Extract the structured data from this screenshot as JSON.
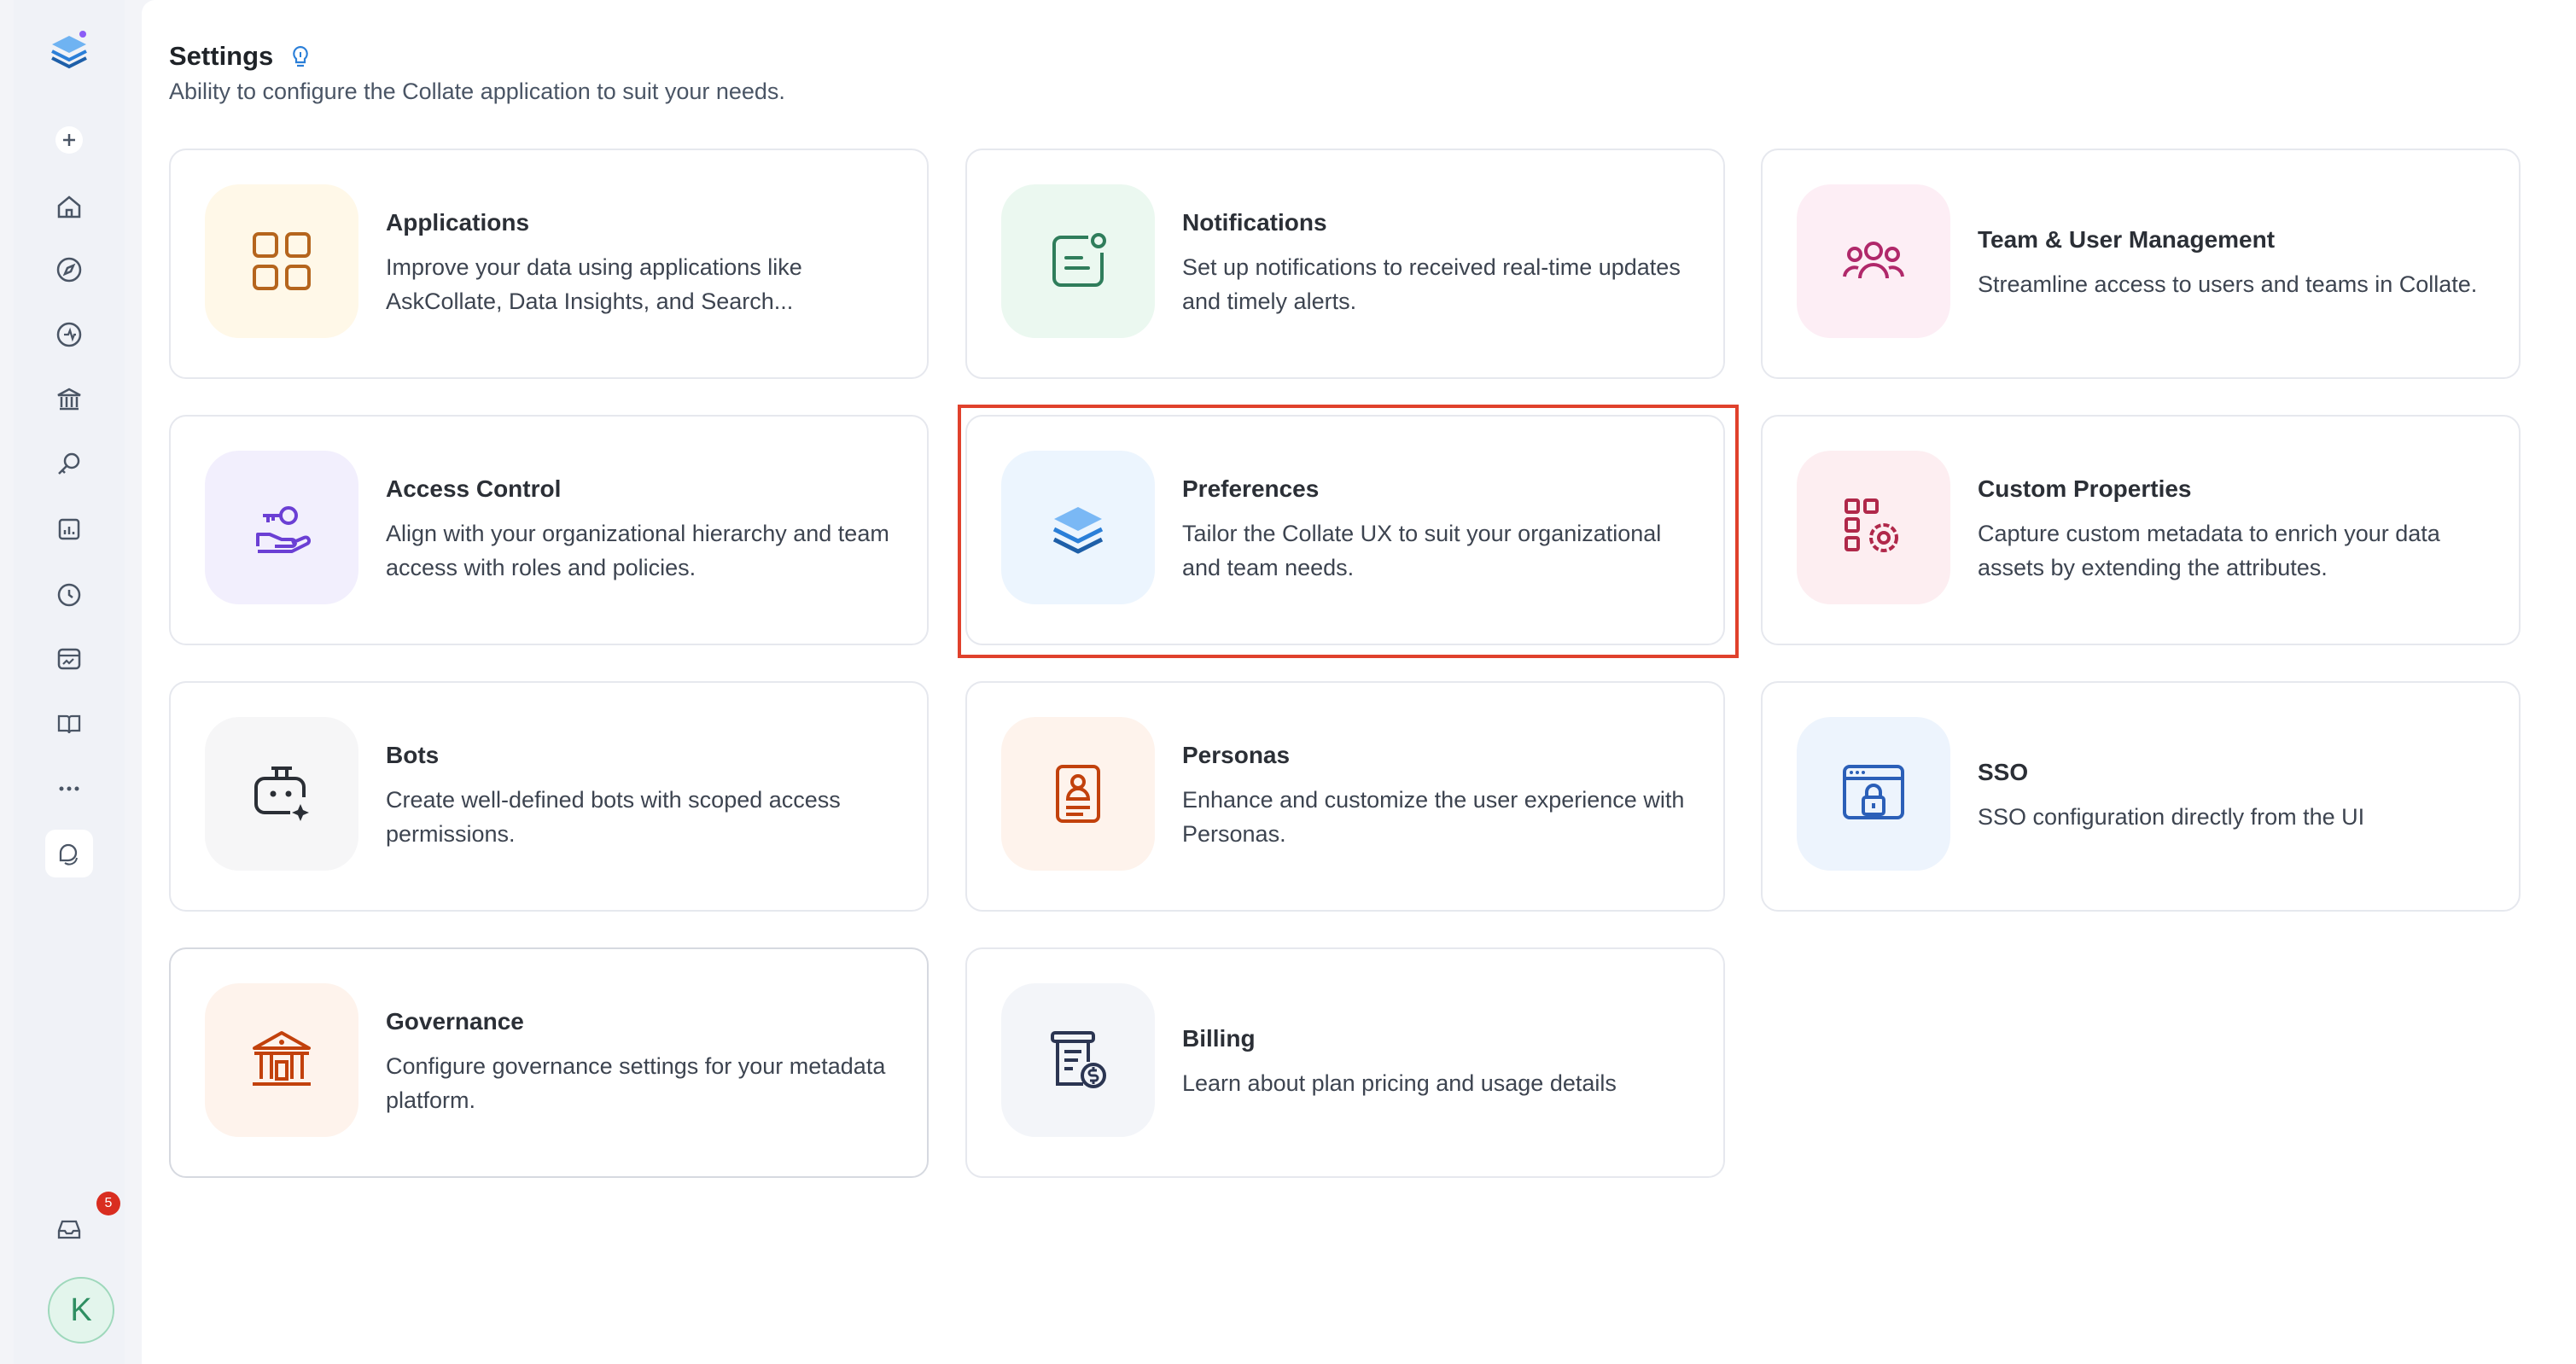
{
  "header": {
    "title": "Settings",
    "subtitle": "Ability to configure the Collate application to suit your needs."
  },
  "sidebar": {
    "items": [
      {
        "icon": "plus-icon"
      },
      {
        "icon": "home-icon"
      },
      {
        "icon": "compass-icon"
      },
      {
        "icon": "data-quality-icon"
      },
      {
        "icon": "governance-icon"
      },
      {
        "icon": "key-search-icon"
      },
      {
        "icon": "insights-icon"
      },
      {
        "icon": "observability-icon"
      },
      {
        "icon": "dashboard-icon"
      },
      {
        "icon": "book-icon"
      },
      {
        "icon": "more-icon"
      },
      {
        "icon": "chat-icon"
      }
    ],
    "notifications_count": "5",
    "avatar_letter": "K"
  },
  "cards": [
    {
      "title": "Applications",
      "description": "Improve your data using applications like AskCollate, Data Insights, and Search...",
      "icon": "grid-icon",
      "color": "#b5651d",
      "bg": "#fff8e8"
    },
    {
      "title": "Notifications",
      "description": "Set up notifications to received real-time updates and timely alerts.",
      "icon": "notification-icon",
      "color": "#2f7d5b",
      "bg": "#ebf8f0"
    },
    {
      "title": "Team & User Management",
      "description": "Streamline access to users and teams in Collate.",
      "icon": "team-icon",
      "color": "#b0286a",
      "bg": "#fdeef5"
    },
    {
      "title": "Access Control",
      "description": "Align with your organizational hierarchy and team access with roles and policies.",
      "icon": "key-hand-icon",
      "color": "#6b3fd4",
      "bg": "#f2effd"
    },
    {
      "title": "Preferences",
      "description": "Tailor the Collate UX to suit your organizational and team needs.",
      "icon": "layers-icon",
      "color": "#2b7fd8",
      "bg": "#ecf5fe"
    },
    {
      "title": "Custom Properties",
      "description": "Capture custom metadata to enrich your data assets by extending the attributes.",
      "icon": "custom-properties-icon",
      "color": "#b0284a",
      "bg": "#fdeef1"
    },
    {
      "title": "Bots",
      "description": "Create well-defined bots with scoped access permissions.",
      "icon": "bot-icon",
      "color": "#2b2f36",
      "bg": "#f6f6f7"
    },
    {
      "title": "Personas",
      "description": "Enhance and customize the user experience with Personas.",
      "icon": "persona-icon",
      "color": "#c2410c",
      "bg": "#fef3ec"
    },
    {
      "title": "SSO",
      "description": "SSO configuration directly from the UI",
      "icon": "sso-lock-icon",
      "color": "#2b5fb8",
      "bg": "#edf4fd"
    },
    {
      "title": "Governance",
      "description": "Configure governance settings for your metadata platform.",
      "icon": "bank-icon",
      "color": "#c2410c",
      "bg": "#fef3ec"
    },
    {
      "title": "Billing",
      "description": "Learn about plan pricing and usage details",
      "icon": "billing-icon",
      "color": "#2b3552",
      "bg": "#f3f5f9"
    }
  ],
  "colors": {
    "highlight": "#e0412c",
    "accent": "#2b7fd8",
    "badge": "#d92d20"
  }
}
